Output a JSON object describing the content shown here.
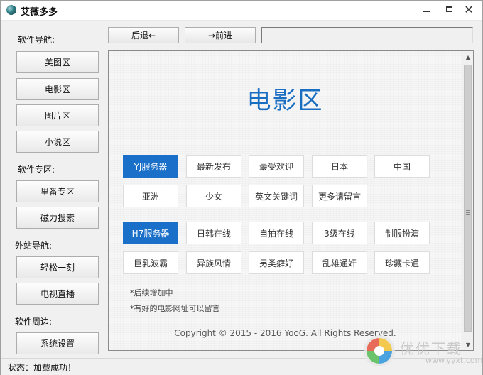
{
  "window": {
    "title": "艾薇多多"
  },
  "sidebar": {
    "sections": [
      {
        "label": "软件导航:",
        "items": [
          "美图区",
          "电影区",
          "图片区",
          "小说区"
        ]
      },
      {
        "label": "软件专区:",
        "items": [
          "里番专区",
          "磁力搜索"
        ]
      },
      {
        "label": "外站导航:",
        "items": [
          "轻松一刻",
          "电视直播"
        ]
      },
      {
        "label": "软件周边:",
        "items": [
          "系统设置"
        ]
      }
    ]
  },
  "nav": {
    "back_label": "后退←",
    "forward_label": "→前进",
    "url_value": ""
  },
  "content": {
    "title": "电影区",
    "groups": [
      {
        "primary": "YJ服务器",
        "tags": [
          "最新发布",
          "最受欢迎",
          "日本",
          "中国",
          "亚洲",
          "少女",
          "英文关键词",
          "更多请留言"
        ]
      },
      {
        "primary": "H7服务器",
        "tags": [
          "日韩在线",
          "自拍在线",
          "3级在线",
          "制服扮演",
          "巨乳波霸",
          "异族风情",
          "另类癖好",
          "乱雄通奸",
          "珍藏卡通"
        ]
      }
    ],
    "notes": [
      "*后续增加中",
      "*有好的电影网址可以留言"
    ],
    "copyright": "Copyright © 2015 - 2016 YooG. All Rights Reserved."
  },
  "status": {
    "text": "状态：加载成功！"
  },
  "watermark": {
    "text": "优优下载",
    "url": "www.yyxt.com"
  },
  "colors": {
    "accent": "#1a6fc8",
    "title": "#1a6ec2"
  },
  "icons": {
    "app": "app-orb-icon",
    "minimize": "minimize-icon",
    "maximize": "maximize-icon",
    "close": "close-icon"
  }
}
